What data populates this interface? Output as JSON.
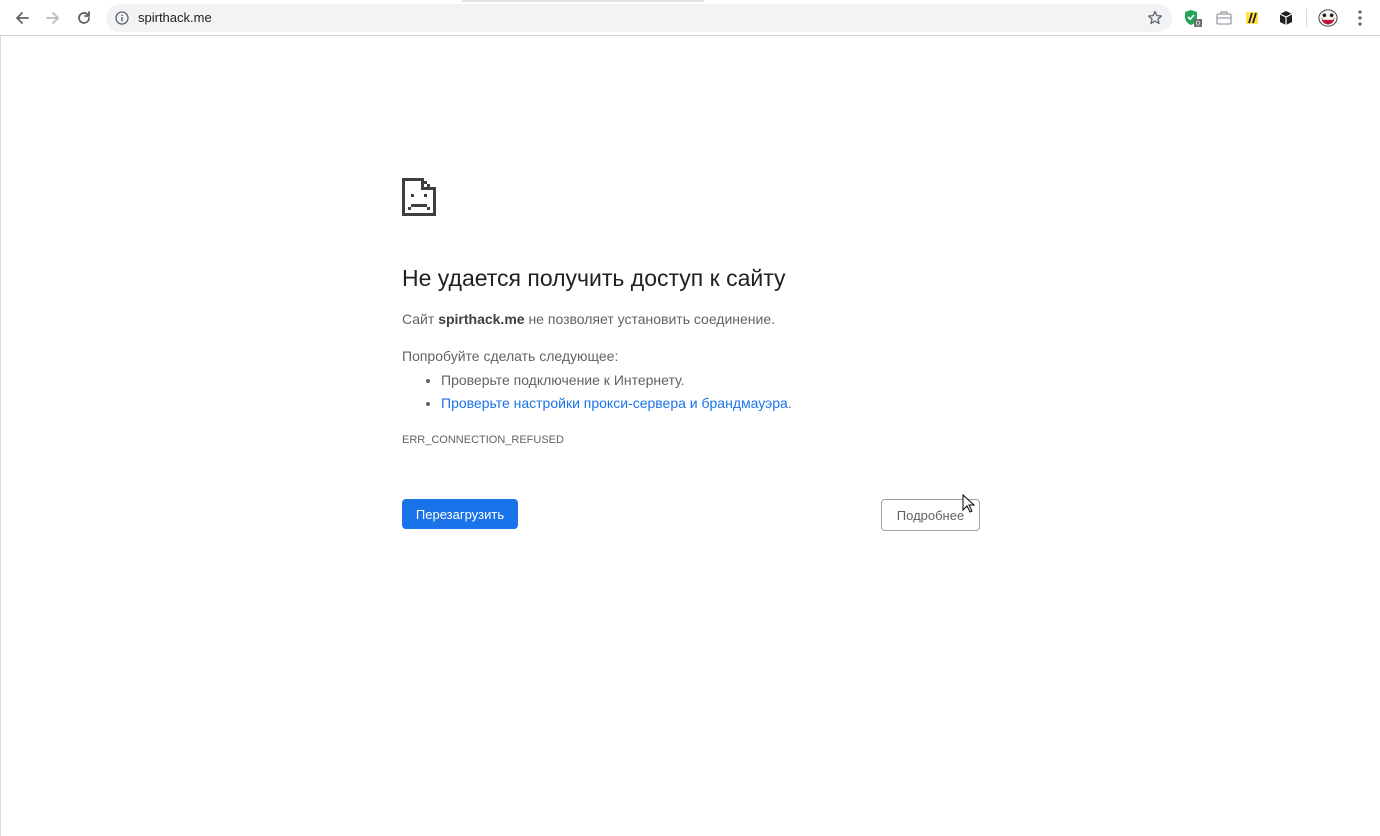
{
  "browser": {
    "url": "spirthack.me",
    "nav_icons": [
      "back-icon",
      "forward-icon",
      "reload-icon"
    ],
    "extensions": [
      {
        "icon": "shield-check-icon",
        "badge": "0"
      },
      {
        "icon": "briefcase-icon"
      },
      {
        "icon": "pen-icon"
      },
      {
        "icon": "box-icon"
      }
    ],
    "profile_icon": "grin-face-icon",
    "menu_icon": "three-dots-icon"
  },
  "error_page": {
    "icon": "sad-document-icon",
    "heading": "Не удается получить доступ к сайту",
    "summary_prefix": "Сайт ",
    "summary_host": "spirthack.me",
    "summary_suffix": " не позволяет установить соединение.",
    "try_title": "Попробуйте сделать следующее:",
    "suggestion_1": "Проверьте подключение к Интернету.",
    "suggestion_2_link": "Проверьте настройки прокси-сервера и брандмауэра",
    "suggestion_2_tail": ".",
    "error_code": "ERR_CONNECTION_REFUSED",
    "reload_button": "Перезагрузить",
    "details_button": "Подробнее"
  },
  "colors": {
    "accent": "#1a73e8",
    "text": "#5f6368",
    "heading": "#202124"
  }
}
